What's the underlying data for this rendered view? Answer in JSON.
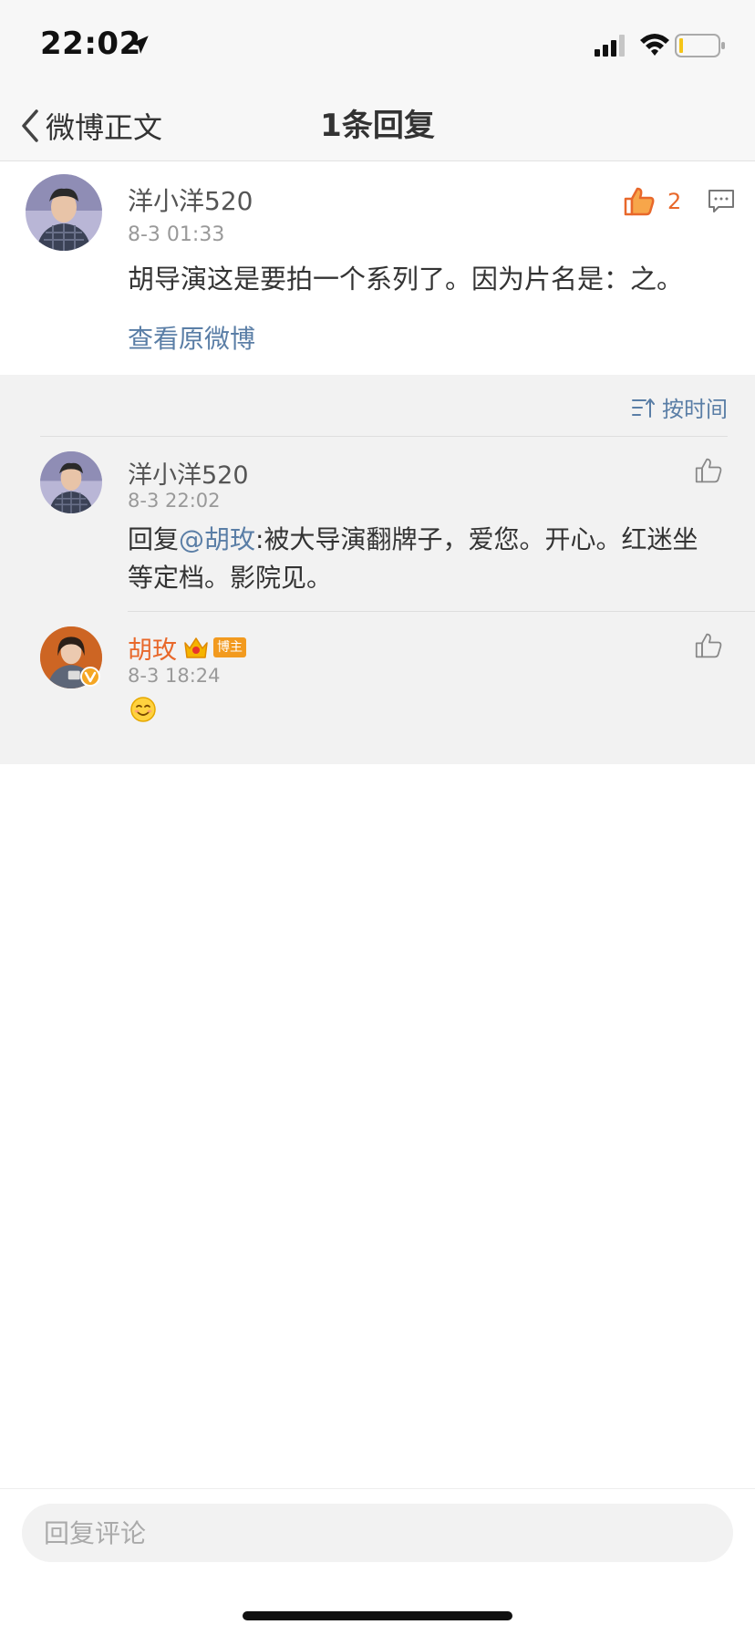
{
  "status_bar": {
    "time": "22:02"
  },
  "nav": {
    "back_label": "微博正文",
    "title": "1条回复"
  },
  "main_comment": {
    "username": "洋小洋520",
    "time": "8-3 01:33",
    "text": "胡导演这是要拍一个系列了。因为片名是：之。",
    "like_count": "2",
    "view_original": "查看原微博"
  },
  "replies_header": {
    "sort_label": "按时间"
  },
  "replies": [
    {
      "username": "洋小洋520",
      "time": "8-3 22:02",
      "reply_prefix": "回复",
      "mention": "@胡玫",
      "text": ":被大导演翻牌子，爱您。开心。红迷坐等定档。影院见。"
    },
    {
      "username": "胡玫",
      "badge": "博主",
      "time": "8-3 18:24"
    }
  ],
  "input": {
    "placeholder": "回复评论"
  },
  "colors": {
    "accent": "#e8682b",
    "link": "#5a7ea6",
    "section_bg": "#f2f2f2"
  }
}
